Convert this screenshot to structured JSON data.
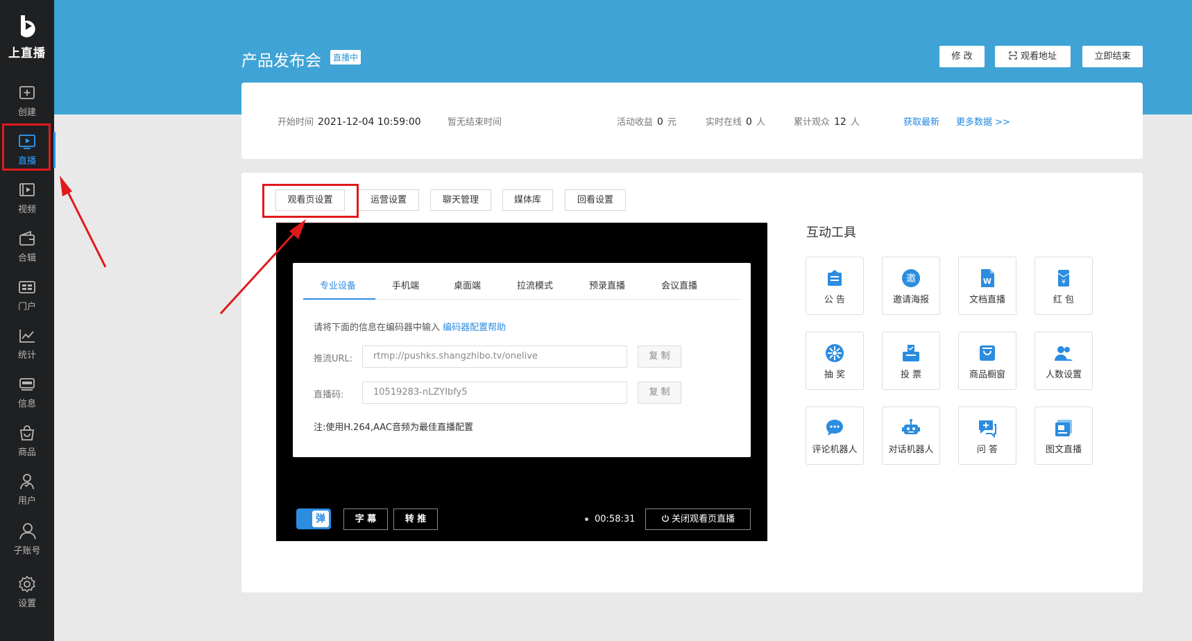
{
  "app": {
    "logo_text": "上直播"
  },
  "sidebar": {
    "items": [
      {
        "icon": "plus-square-icon",
        "label": "创建"
      },
      {
        "icon": "live-play-icon",
        "label": "直播"
      },
      {
        "icon": "video-icon",
        "label": "视频"
      },
      {
        "icon": "wallet-icon",
        "label": "合辑"
      },
      {
        "icon": "portal-icon",
        "label": "门户"
      },
      {
        "icon": "chart-icon",
        "label": "统计"
      },
      {
        "icon": "message-icon",
        "label": "信息"
      },
      {
        "icon": "bag-icon",
        "label": "商品"
      },
      {
        "icon": "user-icon",
        "label": "用户"
      },
      {
        "icon": "sub-account-icon",
        "label": "子账号"
      },
      {
        "icon": "gear-icon",
        "label": "设置"
      }
    ],
    "active_index": 1
  },
  "header": {
    "title": "产品发布会",
    "status_badge": "直播中",
    "buttons": {
      "edit": "修 改",
      "watch_url": "观看地址",
      "end_now": "立即结束"
    }
  },
  "stats": {
    "start_label": "开始时间",
    "start_value": "2021-12-04 10:59:00",
    "end_text": "暂无结束时间",
    "revenue_label": "活动收益",
    "revenue_value": "0",
    "revenue_unit": "元",
    "online_label": "实时在线",
    "online_value": "0",
    "online_unit": "人",
    "total_label": "累计观众",
    "total_value": "12",
    "total_unit": "人",
    "refresh_link": "获取最新",
    "more_link": "更多数据 >>"
  },
  "tabs": [
    "观看页设置",
    "运营设置",
    "聊天管理",
    "媒体库",
    "回看设置"
  ],
  "player": {
    "inner_tabs": [
      "专业设备",
      "手机端",
      "桌面端",
      "拉流模式",
      "预录直播",
      "会议直播"
    ],
    "tip": "请将下面的信息在编码器中输入",
    "tip_link": "编码器配置帮助",
    "push_label": "推流URL:",
    "push_value": "rtmp://pushks.shangzhibo.tv/onelive",
    "code_label": "直播码:",
    "code_value": "10519283-nLZYIbfy5",
    "copy_label": "复 制",
    "note": "注:使用H.264,AAC音频为最佳直播配置",
    "danmu_label": "弹",
    "subtitle_btn": "字 幕",
    "relay_btn": "转 推",
    "time": "00:58:31",
    "close_btn": "关闭观看页直播"
  },
  "tools": {
    "title": "互动工具",
    "items": [
      {
        "icon": "announcement-icon",
        "label": "公 告"
      },
      {
        "icon": "invite-poster-icon",
        "label": "邀请海报"
      },
      {
        "icon": "document-live-icon",
        "label": "文档直播"
      },
      {
        "icon": "red-packet-icon",
        "label": "红 包"
      },
      {
        "icon": "lottery-icon",
        "label": "抽 奖"
      },
      {
        "icon": "vote-icon",
        "label": "投 票"
      },
      {
        "icon": "shop-window-icon",
        "label": "商品橱窗"
      },
      {
        "icon": "people-count-icon",
        "label": "人数设置"
      },
      {
        "icon": "comment-robot-icon",
        "label": "评论机器人"
      },
      {
        "icon": "chat-robot-icon",
        "label": "对话机器人"
      },
      {
        "icon": "qa-icon",
        "label": "问 答"
      },
      {
        "icon": "image-text-icon",
        "label": "图文直播"
      }
    ]
  },
  "colors": {
    "brand_blue": "#3fa3d5",
    "accent": "#2b8ce0",
    "annotation_red": "#e0191c"
  }
}
